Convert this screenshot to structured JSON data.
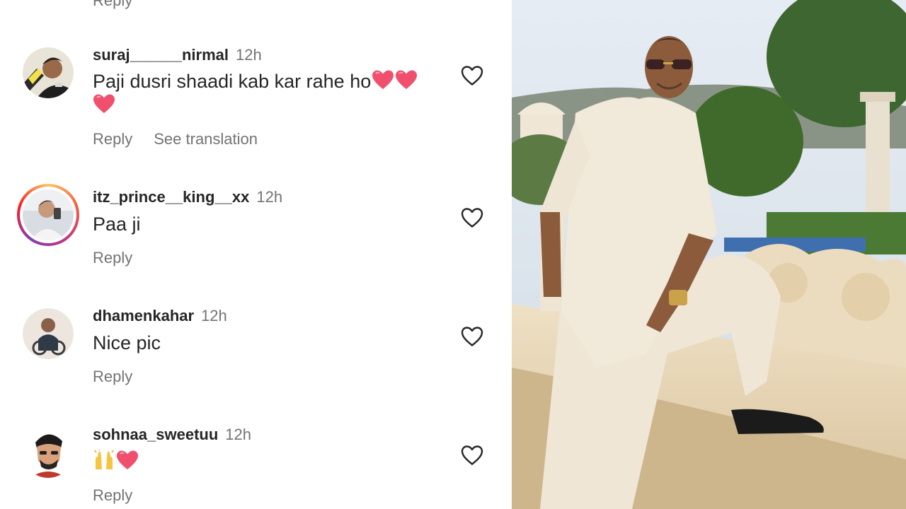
{
  "comments_top_reply": "Reply",
  "comments": [
    {
      "username": "suraj______nirmal",
      "time": "12h",
      "text": "Paji dusri shaadi kab kar rahe ho",
      "emojis": [
        "red-heart",
        "red-heart",
        "red-heart"
      ],
      "reply_label": "Reply",
      "translate_label": "See translation"
    },
    {
      "username": "itz_prince__king__xx",
      "time": "12h",
      "text": "Paa ji",
      "reply_label": "Reply"
    },
    {
      "username": "dhamenkahar",
      "time": "12h",
      "text": "Nice pic",
      "reply_label": "Reply"
    },
    {
      "username": "sohnaa_sweetuu",
      "time": "12h",
      "text": "",
      "emojis": [
        "raising-hands",
        "red-heart"
      ],
      "reply_label": "Reply"
    }
  ],
  "icons": {
    "like": "heart-outline-icon",
    "emoji_heart": "red-heart",
    "emoji_hands": "raising-hands"
  },
  "colors": {
    "username": "#262626",
    "secondary_text": "#737373",
    "heart_emoji": "#f0506e",
    "story_ring": "#c13584"
  }
}
